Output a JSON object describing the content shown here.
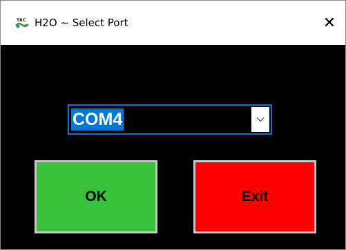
{
  "window": {
    "title": "H2O ~ Select Port",
    "close_glyph": "✕",
    "icon": "trc-app-icon"
  },
  "port_select": {
    "value": "COM4",
    "arrow_icon": "chevron-down-icon"
  },
  "buttons": {
    "ok_label": "OK",
    "exit_label": "Exit"
  },
  "colors": {
    "background": "#000000",
    "titlebar": "#ffffff",
    "selection": "#0078d7",
    "ok": "#36c23a",
    "exit": "#ff0000",
    "button_border": "#c8c8c8"
  }
}
